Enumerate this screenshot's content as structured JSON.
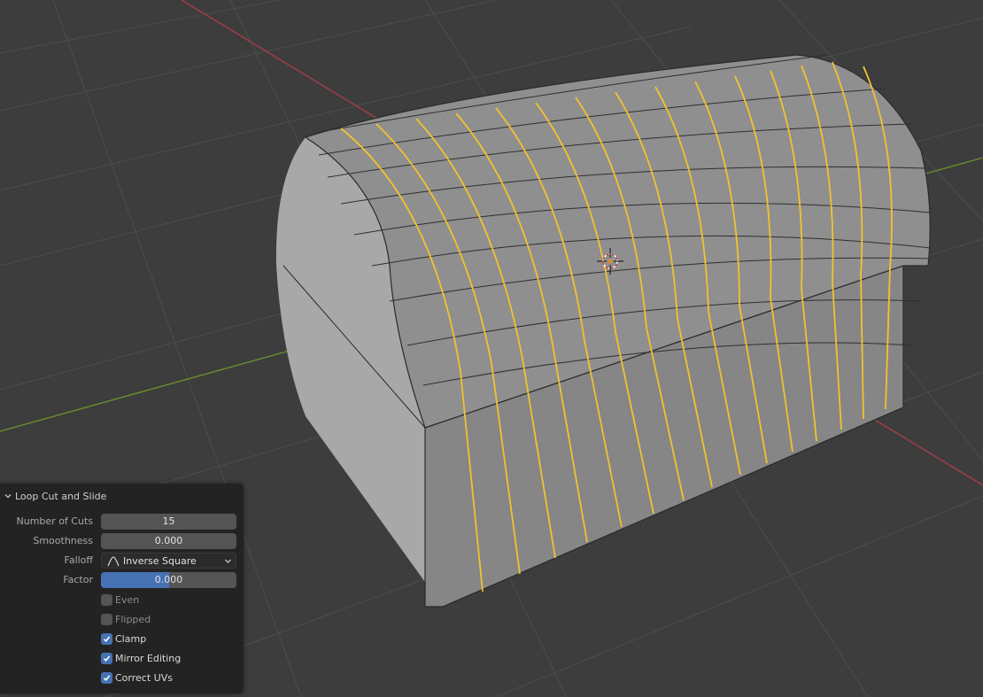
{
  "operator_panel": {
    "title": "Loop Cut and Slide",
    "fields": {
      "number_of_cuts": {
        "label": "Number of Cuts",
        "value": "15"
      },
      "smoothness": {
        "label": "Smoothness",
        "value": "0.000"
      },
      "falloff": {
        "label": "Falloff",
        "value": "Inverse Square",
        "icon": "inverse-square-curve-icon"
      },
      "factor": {
        "label": "Factor",
        "value": "0.000",
        "fill_fraction": 0.5
      }
    },
    "checkboxes": [
      {
        "label": "Even",
        "checked": false
      },
      {
        "label": "Flipped",
        "checked": false
      },
      {
        "label": "Clamp",
        "checked": true
      },
      {
        "label": "Mirror Editing",
        "checked": true
      },
      {
        "label": "Correct UVs",
        "checked": true
      }
    ]
  },
  "viewport": {
    "colors": {
      "background": "#3d3d3d",
      "grid": "#4a4a4a",
      "x_axis": "#a63e47",
      "y_axis": "#6b8e2c",
      "mesh_face": "#9a9a9a",
      "edge_loop_selected": "#f2c22e",
      "accent": "#4772b3"
    },
    "cursor_icon": "3d-cursor-icon"
  }
}
